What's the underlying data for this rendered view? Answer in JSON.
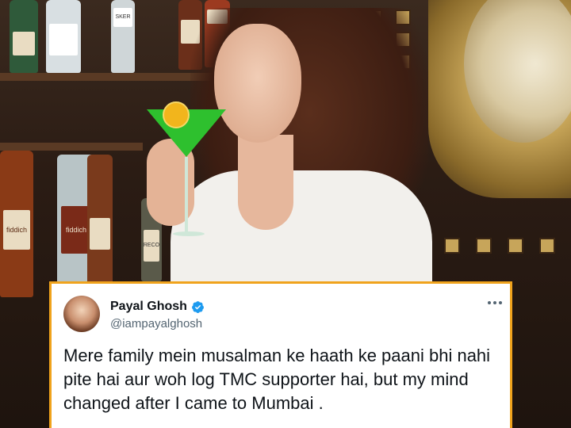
{
  "tweet": {
    "author_name": "Payal Ghosh",
    "author_handle": "@iampayalghosh",
    "verified": true,
    "text": "Mere family mein musalman ke haath ke paani bhi nahi pite hai aur woh log TMC supporter hai, but my mind changed after I came to Mumbai .",
    "border_color": "#f0a31c",
    "verified_color": "#1d9bf0"
  },
  "photo": {
    "bottle_labels": [
      "SKER",
      "fiddich",
      "fiddich",
      "RECO"
    ]
  },
  "icons": {
    "more": "more-horizontal-icon",
    "verified": "verified-badge-icon"
  }
}
